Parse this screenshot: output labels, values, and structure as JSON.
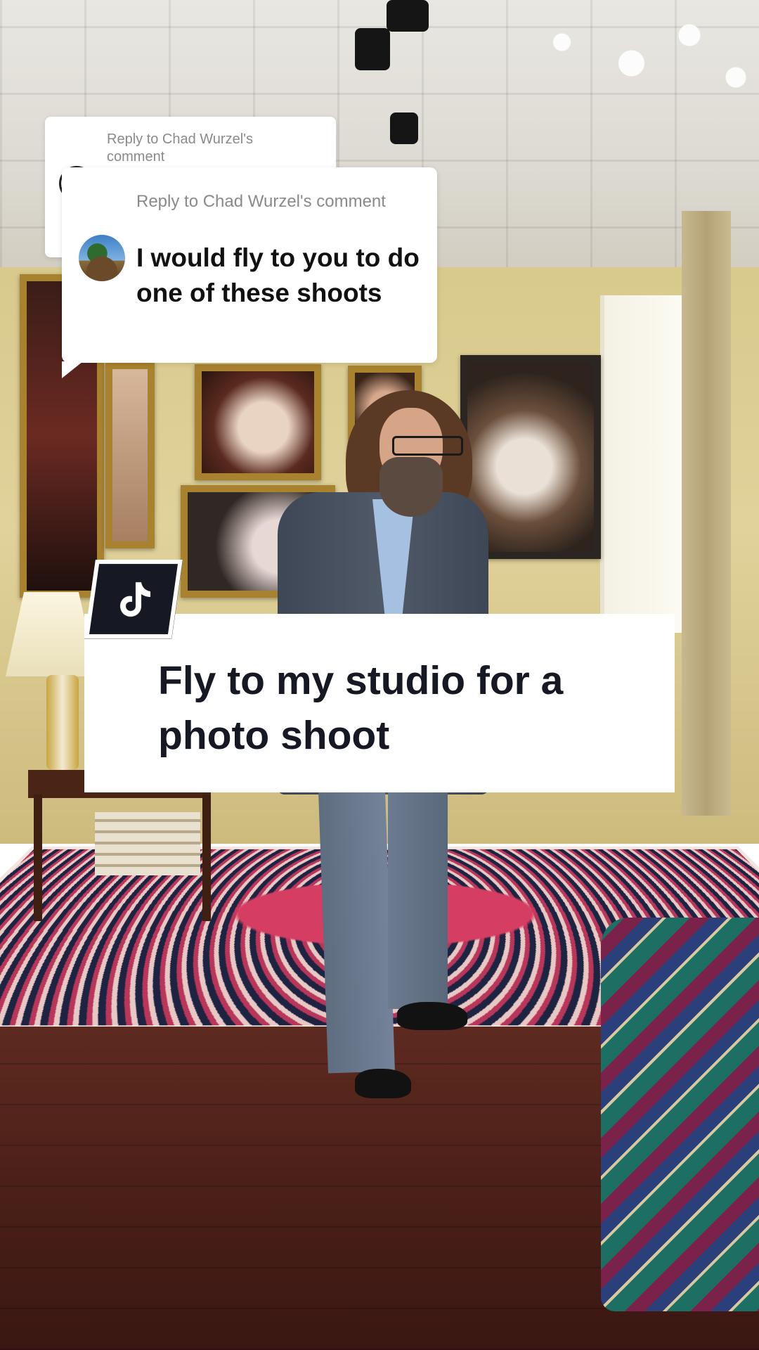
{
  "back_comment": {
    "reply_label": "Reply to Chad Wurzel's comment"
  },
  "front_comment": {
    "reply_label": "Reply to Chad Wurzel's comment",
    "text": "I would fly to you to do one of these shoots"
  },
  "caption": {
    "text": "Fly to my studio for a photo shoot"
  },
  "icons": {
    "badge": "tiktok-logo-icon"
  },
  "colors": {
    "caption_text": "#161823",
    "badge_bg": "#161823",
    "reply_label": "#8a8a8a"
  }
}
